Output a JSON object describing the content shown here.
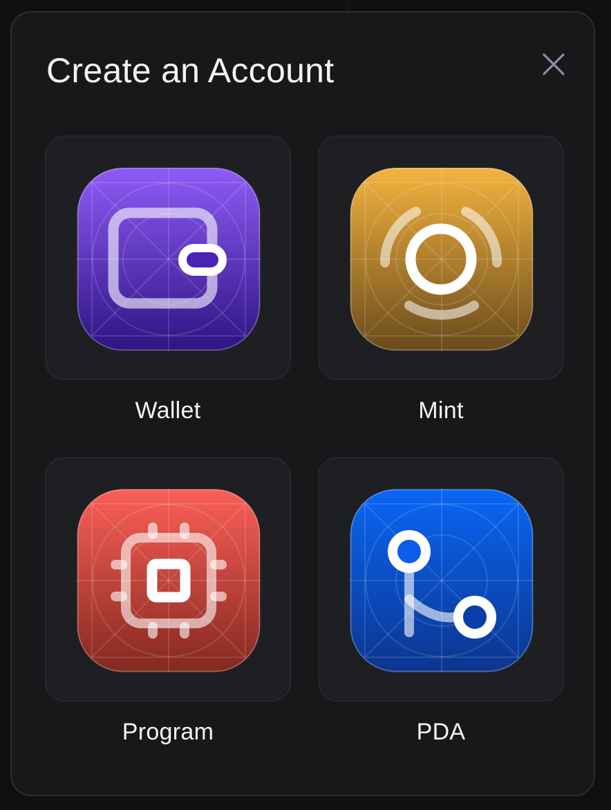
{
  "dialog": {
    "title": "Create an Account",
    "close_icon": "close-icon"
  },
  "options": [
    {
      "label": "Wallet",
      "icon": "wallet-icon",
      "colors": [
        "#8f5bf6",
        "#2e1483"
      ]
    },
    {
      "label": "Mint",
      "icon": "mint-icon",
      "colors": [
        "#f3b33e",
        "#6a4b1c"
      ]
    },
    {
      "label": "Program",
      "icon": "chip-icon",
      "colors": [
        "#fb5f58",
        "#84291f"
      ]
    },
    {
      "label": "PDA",
      "icon": "pda-branch-icon",
      "colors": [
        "#0a66f5",
        "#0c358f"
      ]
    }
  ]
}
